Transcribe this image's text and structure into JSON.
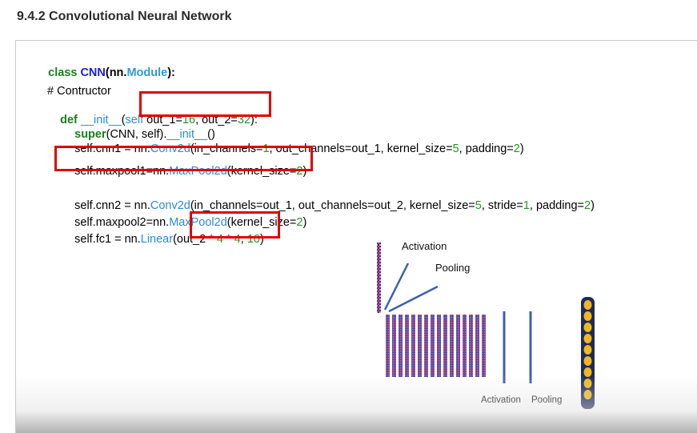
{
  "heading": "9.4.2 Convolutional Neural Network",
  "code": {
    "line1": {
      "kw": "class ",
      "name": "CNN",
      "p1": "(nn.",
      "mod": "Module",
      "p2": "):"
    },
    "comment": "# Contructor",
    "line3": {
      "kw": "def",
      "fn": " __init__",
      "p": "(",
      "self": "self",
      "a": " out_1=",
      "n1": "16",
      "b": ", out_2=",
      "n2": "32",
      "c": "):"
    },
    "line4": {
      "kw": "super",
      "a": "(CNN, self).",
      "fn": "__init__",
      "b": "()"
    },
    "line5": {
      "a": "self.cnn1 = nn.",
      "cls": "Conv2d",
      "b": "(in_channels=",
      "n1": "1",
      "c": ", out_channels=out_1, kernel_size=",
      "n2": "5",
      "d": ", padding=",
      "n3": "2",
      "e": ")"
    },
    "line6": {
      "a": "self.maxpool1=nn.",
      "cls": "MaxPool2d",
      "b": "(kernel_size=",
      "n1": "2",
      "c": ")"
    },
    "line7": {
      "a": "self.cnn2 = nn.",
      "cls": "Conv2d",
      "b": "(in_channels=out_1, out_channels=out_2, kernel_size=",
      "n1": "5",
      "c": ", stride=",
      "n2": "1",
      "d": ", padding=",
      "n3": "2",
      "e": ")"
    },
    "line8": {
      "a": "self.maxpool2=nn.",
      "cls": "MaxPool2d",
      "b": "(kernel_size=",
      "n1": "2",
      "c": ")"
    },
    "line9": {
      "a": "self.fc1 = nn.",
      "cls": "Linear",
      "b": "(out_2 * ",
      "n1": "4",
      "c": " * ",
      "n2": "4",
      "d": ", ",
      "n3": "10",
      "e": ")"
    }
  },
  "diagram": {
    "label_activation_top": "Activation",
    "label_pooling_top": "Pooling",
    "label_activation_bottom": "Activation",
    "label_pooling_bottom": "Pooling"
  },
  "colors": {
    "highlight": "#e10000",
    "keyword": "#1b7f1b",
    "class_name": "#2c8ad6",
    "number": "#1b9a1b"
  }
}
